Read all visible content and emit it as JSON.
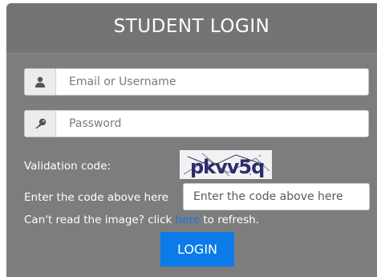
{
  "header": {
    "title": "STUDENT LOGIN"
  },
  "login_form": {
    "email_placeholder": "Email or Username",
    "password_placeholder": "Password",
    "validation_label": "Validation code:",
    "captcha_text": "pkvv5q",
    "code_label": "Enter the code above here",
    "code_placeholder": "Enter the code above here",
    "refresh_prefix": "Can't read the image? click ",
    "refresh_link": "here",
    "refresh_suffix": " to refresh.",
    "login_button": "LOGIN"
  },
  "colors": {
    "panel": "#7d7d7d",
    "header": "#747474",
    "button": "#0a7be8",
    "link": "#1a73e8"
  },
  "icons": {
    "email": "user-icon",
    "password": "key-icon"
  }
}
